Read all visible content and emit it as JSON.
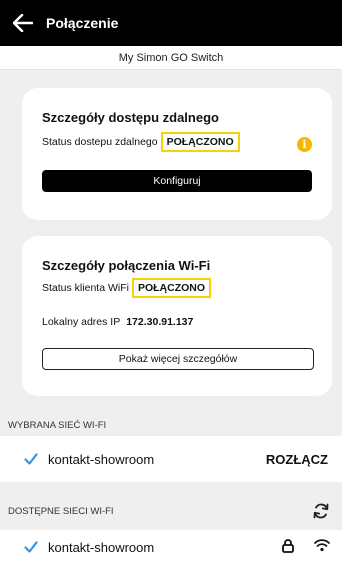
{
  "header": {
    "title": "Połączenie",
    "subtitle": "My Simon GO Switch"
  },
  "remote_access": {
    "title": "Szczegóły dostępu zdalnego",
    "status_label": "Status dostepu zdalnego",
    "status_value": "POŁĄCZONO",
    "configure_label": "Konfiguruj"
  },
  "wifi_details": {
    "title": "Szczegóły połączenia Wi-Fi",
    "status_label": "Status klienta WiFi",
    "status_value": "POŁĄCZONO",
    "ip_label": "Lokalny adres IP",
    "ip_value": "172.30.91.137",
    "more_label": "Pokaż więcej szczegółów"
  },
  "selected_network": {
    "header": "WYBRANA SIEĆ WI-FI",
    "name": "kontakt-showroom",
    "disconnect_label": "ROZŁĄCZ"
  },
  "available_networks": {
    "header": "DOSTĘPNE SIECI WI-FI",
    "items": [
      {
        "name": "kontakt-showroom"
      }
    ]
  },
  "colors": {
    "accent_check": "#3a8fe0",
    "highlight_border": "#f5d20a",
    "info_icon": "#f5b800"
  }
}
